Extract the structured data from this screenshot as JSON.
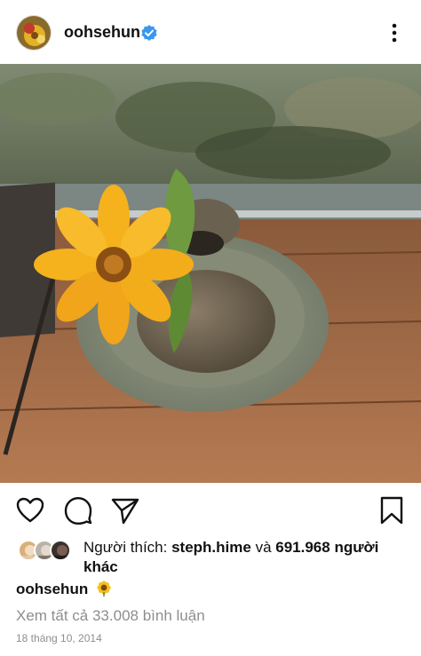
{
  "post": {
    "username": "oohsehun",
    "verified": true,
    "likes": {
      "prefix": "Người thích:",
      "first_user": "steph.hime",
      "conjunction": "và",
      "others": "691.968 người khác"
    },
    "caption_username": "oohsehun",
    "caption_emoji": "sunflower",
    "view_comments": "Xem tất cả 33.008 bình luận",
    "date": "18 tháng 10, 2014"
  },
  "icons": {
    "more": "more-vertical-icon",
    "like": "heart-icon",
    "comment": "comment-icon",
    "share": "send-icon",
    "save": "bookmark-icon",
    "verified": "verified-badge-icon"
  },
  "colors": {
    "verified_blue": "#3897f0",
    "muted_text": "#8e8e8e"
  }
}
